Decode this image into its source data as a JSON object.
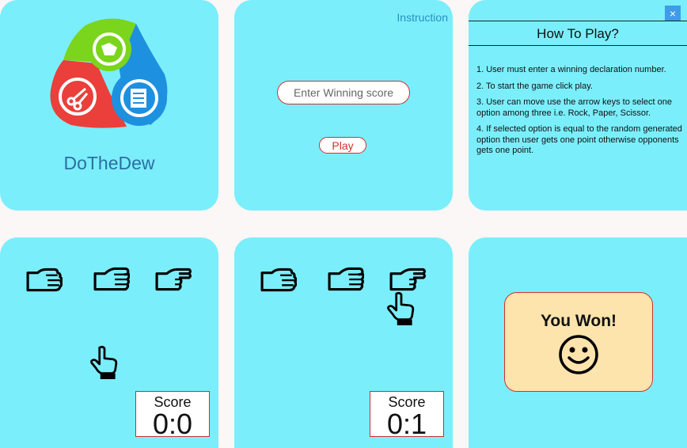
{
  "splash": {
    "app_name": "DoTheDew"
  },
  "setup": {
    "instruction_link": "Instruction",
    "score_placeholder": "Enter Winning score",
    "play_label": "Play"
  },
  "howto": {
    "close_label": "×",
    "title": "How To Play?",
    "steps": [
      "1. User must enter a winning declaration number.",
      "2. To start the game click play.",
      "3. User can move use the arrow keys to select one option among three i.e. Rock, Paper, Scissor.",
      "4. If selected option is equal to the random generated option then user gets one point otherwise opponents gets one point."
    ]
  },
  "game1": {
    "score_label": "Score",
    "score_value": "0:0"
  },
  "game2": {
    "score_label": "Score",
    "score_value": "0:1"
  },
  "result": {
    "message": "You Won!"
  },
  "colors": {
    "panel": "#7beefb",
    "accent_red": "#d23030",
    "won_bg": "#fde4ac",
    "title_blue": "#2a6fa4"
  },
  "icons": [
    "scissors-icon",
    "rock-icon",
    "paper-icon",
    "rock-hand-icon",
    "paper-hand-icon",
    "scissor-hand-icon",
    "pointer-hand-icon",
    "smiley-icon",
    "close-icon"
  ]
}
